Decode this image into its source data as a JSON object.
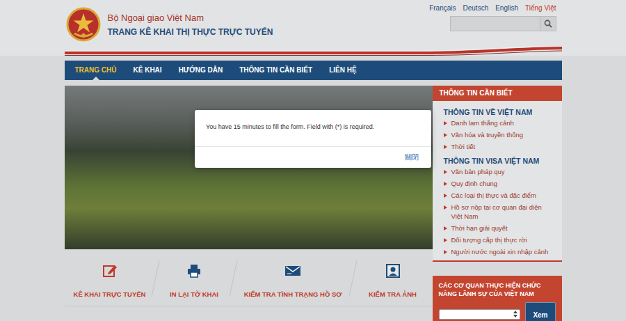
{
  "header": {
    "ministry": "Bộ Ngoại giao Việt Nam",
    "title": "TRANG KÊ KHAI THỊ THỰC TRỰC TUYẾN"
  },
  "languages": [
    {
      "label": "Français",
      "selected": false
    },
    {
      "label": "Deutsch",
      "selected": false
    },
    {
      "label": "English",
      "selected": false
    },
    {
      "label": "Tiếng Việt",
      "selected": true
    }
  ],
  "nav": [
    {
      "label": "TRANG CHỦ",
      "selected": true
    },
    {
      "label": "KÊ KHAI",
      "selected": false
    },
    {
      "label": "HƯỚNG DẪN",
      "selected": false
    },
    {
      "label": "THÔNG TIN CẦN BIẾT",
      "selected": false
    },
    {
      "label": "LIÊN HỆ",
      "selected": false
    }
  ],
  "sidebar": {
    "title": "THÔNG TIN CẦN BIẾT",
    "sections": [
      {
        "title": "THÔNG TIN VỀ VIỆT NAM",
        "items": [
          "Danh lam thắng cảnh",
          "Văn hóa và truyền thống",
          "Thời tiết"
        ]
      },
      {
        "title": "THÔNG TIN VISA VIỆT NAM",
        "items": [
          "Văn bản pháp quy",
          "Quy định chung",
          "Các loại thị thực và đặc điểm",
          "Hồ sơ nộp tại cơ quan đại diện Việt Nam",
          "Thời hạn giải quyết",
          "Đối tượng cấp thị thực rời",
          "Người nước ngoài xin nhập cảnh"
        ]
      }
    ]
  },
  "quick_links": [
    "KÊ KHAI TRỰC TUYẾN",
    "IN LẠI TỜ KHAI",
    "KIỂM TRA TÌNH TRẠNG HỒ SƠ",
    "KIỂM TRA ẢNH"
  ],
  "consulate": {
    "title": "CÁC CƠ QUAN THỰC HIỆN CHỨC NĂNG LÃNH SỰ CỦA VIỆT NAM",
    "button": "Xem"
  },
  "modal": {
    "message": "You have 15 minutes to fill the form. Field with (*) is required.",
    "close": "關閉"
  }
}
